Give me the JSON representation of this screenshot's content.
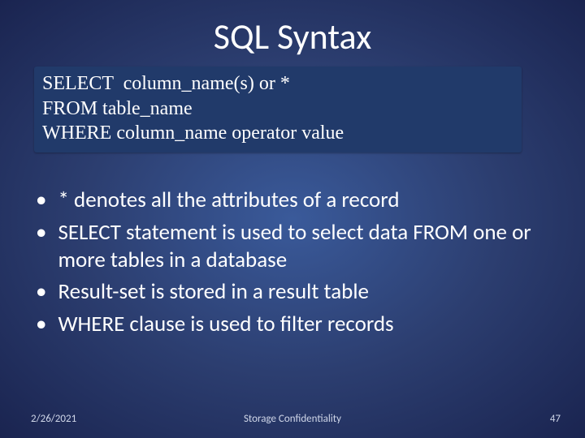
{
  "title": "SQL Syntax",
  "code": {
    "line1": "SELECT  column_name(s) or *",
    "line2": "FROM table_name",
    "line3": "WHERE column_name operator value"
  },
  "bullets": [
    "* denotes all the attributes of a record",
    "SELECT statement is used to select data FROM one or more tables in a database",
    "Result-set is stored in a result table",
    "WHERE clause is used to filter records"
  ],
  "footer": {
    "date": "2/26/2021",
    "center": "Storage Confidentiality",
    "page": "47"
  }
}
